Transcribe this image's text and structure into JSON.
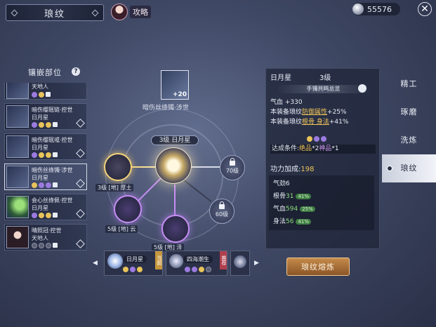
{
  "header": {
    "title": "琅纹",
    "guide_label": "攻略",
    "currency_value": "55576"
  },
  "inlay": {
    "header": "镶嵌部位",
    "help": "?",
    "slots": [
      {
        "name": "天地人",
        "sub": ""
      },
      {
        "name": "暗伤缨珉链·控世",
        "sub": "日月星"
      },
      {
        "name": "暗伤缨珉戒·控世",
        "sub": "日月星"
      },
      {
        "name": "暗伤丝绦镯·涉世",
        "sub": "日月星"
      },
      {
        "name": "会心丝绦佩·控世",
        "sub": "日月星"
      },
      {
        "name": "晴照冠·控世",
        "sub": "天地人"
      }
    ]
  },
  "wheel": {
    "top_gem_value": "+20",
    "top_gem_name": "暗伤丝绦镯·涉世",
    "core_label": "3级 日月星",
    "node_gold_label": "3级 [地] 厚土",
    "node_v1_label": "5级 [地] 云",
    "node_v2_label": "5级 [地] 泽",
    "locked_70": "70级",
    "locked_60": "60级"
  },
  "carousel": {
    "card1_name": "日月星",
    "card1_tag": "当前",
    "card2_name": "四海潮生",
    "card2_tag": "推荐",
    "left_arrow": "◀",
    "right_arrow": "▶"
  },
  "info": {
    "name": "日月星",
    "level": "3级",
    "set_overview": "手镯共鸣总览",
    "stat1": "气血 +330",
    "stat2_pre": "本装备琅纹",
    "stat2_hl": "防御属性",
    "stat2_post": "+25%",
    "stat3_pre": "本装备琅纹",
    "stat3_hl": "根骨 身法",
    "stat3_post": "+41%",
    "achieve_pre": "达成条件:",
    "achieve_a": "绝品",
    "achieve_mid": "*2",
    "achieve_b": "神品",
    "achieve_post": "*1",
    "power_label": "功力加成:",
    "power_value": "198",
    "rows": [
      {
        "label": "气劲",
        "value": "6",
        "pct": ""
      },
      {
        "label": "根骨",
        "value": "31",
        "pct": "41%"
      },
      {
        "label": "气血",
        "value": "594",
        "pct": "25%"
      },
      {
        "label": "身法",
        "value": "56",
        "pct": "41%"
      }
    ]
  },
  "tabs": [
    "精工",
    "琢磨",
    "洗炼",
    "琅纹"
  ],
  "forge_button": "琅纹熔炼"
}
